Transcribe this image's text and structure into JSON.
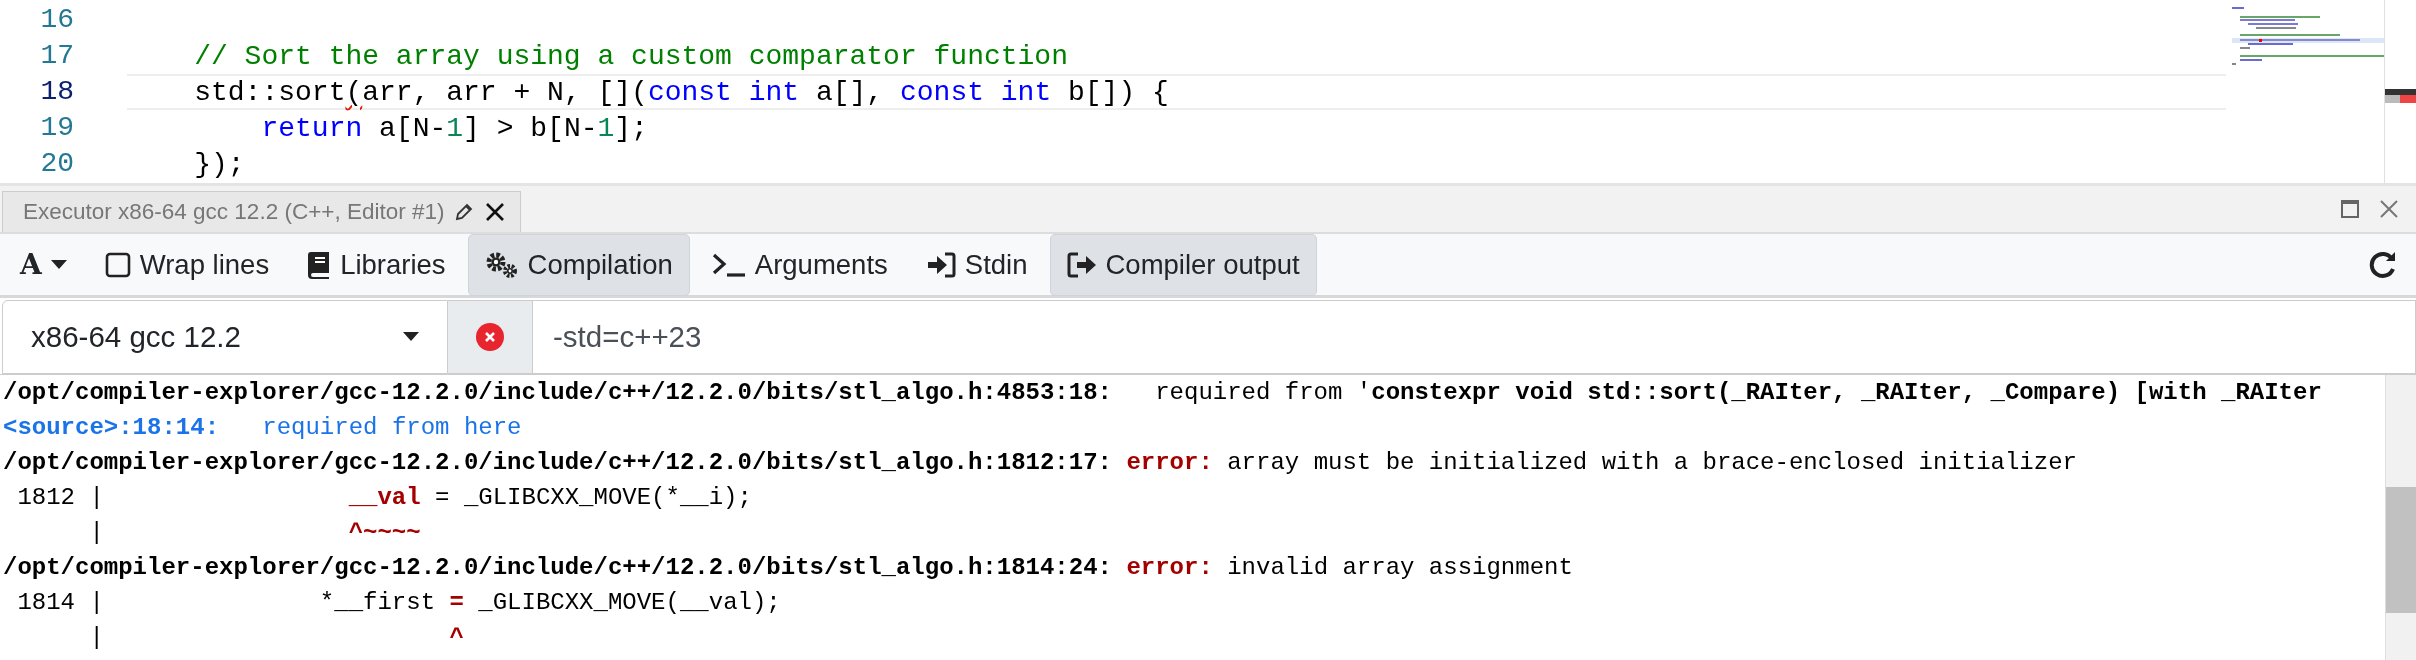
{
  "editor": {
    "lines": [
      {
        "number": "16",
        "current": false
      },
      {
        "number": "17",
        "current": false,
        "segments": [
          {
            "text": "    // Sort the array using a custom comparator function",
            "kind": "comment"
          }
        ]
      },
      {
        "number": "18",
        "current": true,
        "segments": [
          {
            "text": "    std::sort",
            "kind": "plain"
          },
          {
            "text": "(",
            "kind": "squiggle"
          },
          {
            "text": "arr, arr + N, [](",
            "kind": "plain"
          },
          {
            "text": "const int",
            "kind": "keyword"
          },
          {
            "text": " a[], ",
            "kind": "plain"
          },
          {
            "text": "const int",
            "kind": "keyword"
          },
          {
            "text": " b[]) {",
            "kind": "plain"
          }
        ]
      },
      {
        "number": "19",
        "current": false,
        "segments": [
          {
            "text": "        return",
            "kind": "keyword"
          },
          {
            "text": " a[N-",
            "kind": "plain"
          },
          {
            "text": "1",
            "kind": "number"
          },
          {
            "text": "] > b[N-",
            "kind": "plain"
          },
          {
            "text": "1",
            "kind": "number"
          },
          {
            "text": "];",
            "kind": "plain"
          }
        ]
      },
      {
        "number": "20",
        "current": false,
        "segments": [
          {
            "text": "    });",
            "kind": "plain"
          }
        ]
      }
    ]
  },
  "pane": {
    "tab": {
      "title": "Executor x86-64 gcc 12.2 (C++, Editor #1)"
    },
    "toolbar": [
      {
        "kind": "font-menu",
        "label": "A"
      },
      {
        "kind": "checkbox",
        "label": "Wrap lines",
        "checked": false
      },
      {
        "kind": "toggle",
        "label": "Libraries",
        "selected": false
      },
      {
        "kind": "toggle",
        "label": "Compilation",
        "selected": true
      },
      {
        "kind": "toggle",
        "label": "Arguments",
        "selected": false
      },
      {
        "kind": "toggle",
        "label": "Stdin",
        "selected": false
      },
      {
        "kind": "toggle",
        "label": "Compiler output",
        "selected": true
      }
    ],
    "compiler": {
      "name": "x86-64 gcc 12.2",
      "error": true,
      "options": "-std=c++23"
    },
    "output": [
      {
        "segments": [
          {
            "text": "/opt/compiler-explorer/gcc-12.2.0/include/c++/12.2.0/bits/stl_algo.h:4853:18:",
            "kind": "path"
          },
          {
            "text": "   required from '",
            "kind": "plain"
          },
          {
            "text": "constexpr void std::sort(_RAIter, _RAIter, _Compare) [with _RAIter",
            "kind": "bold"
          }
        ]
      },
      {
        "segments": [
          {
            "text": "<source>:18:14:",
            "kind": "location"
          },
          {
            "text": "   required from here",
            "kind": "note"
          }
        ]
      },
      {
        "segments": [
          {
            "text": "/opt/compiler-explorer/gcc-12.2.0/include/c++/12.2.0/bits/stl_algo.h:1812:17:",
            "kind": "path"
          },
          {
            "text": " error:",
            "kind": "error"
          },
          {
            "text": " array must be initialized with a brace-enclosed initializer",
            "kind": "plain"
          }
        ]
      },
      {
        "segments": [
          {
            "text": " 1812 |                 ",
            "kind": "plain"
          },
          {
            "text": "__val",
            "kind": "highlight"
          },
          {
            "text": " = _GLIBCXX_MOVE(*__i);",
            "kind": "plain"
          }
        ]
      },
      {
        "segments": [
          {
            "text": "      |                 ",
            "kind": "plain"
          },
          {
            "text": "^~~~~",
            "kind": "highlight"
          }
        ]
      },
      {
        "segments": [
          {
            "text": "/opt/compiler-explorer/gcc-12.2.0/include/c++/12.2.0/bits/stl_algo.h:1814:24:",
            "kind": "path"
          },
          {
            "text": " error:",
            "kind": "error"
          },
          {
            "text": " invalid array assignment",
            "kind": "plain"
          }
        ]
      },
      {
        "segments": [
          {
            "text": " 1814 |               *__first ",
            "kind": "plain"
          },
          {
            "text": "=",
            "kind": "highlight"
          },
          {
            "text": " _GLIBCXX_MOVE(__val);",
            "kind": "plain"
          }
        ]
      },
      {
        "segments": [
          {
            "text": "      |                        ",
            "kind": "plain"
          },
          {
            "text": "^",
            "kind": "highlight"
          }
        ]
      }
    ]
  }
}
